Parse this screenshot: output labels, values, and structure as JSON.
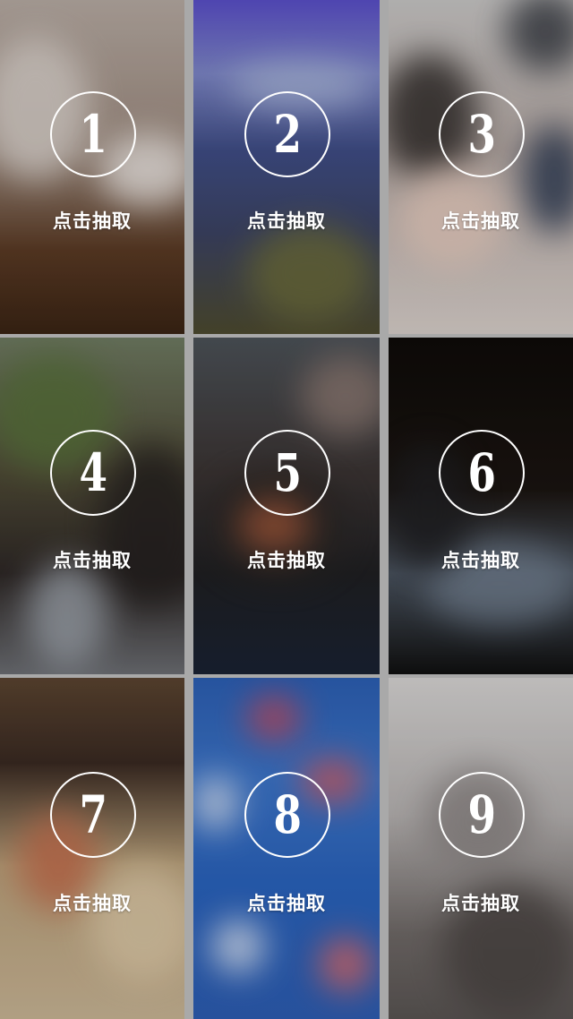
{
  "cards": [
    {
      "number": "1",
      "label": "点击抽取"
    },
    {
      "number": "2",
      "label": "点击抽取"
    },
    {
      "number": "3",
      "label": "点击抽取"
    },
    {
      "number": "4",
      "label": "点击抽取"
    },
    {
      "number": "5",
      "label": "点击抽取"
    },
    {
      "number": "6",
      "label": "点击抽取"
    },
    {
      "number": "7",
      "label": "点击抽取"
    },
    {
      "number": "8",
      "label": "点击抽取"
    },
    {
      "number": "9",
      "label": "点击抽取"
    }
  ]
}
